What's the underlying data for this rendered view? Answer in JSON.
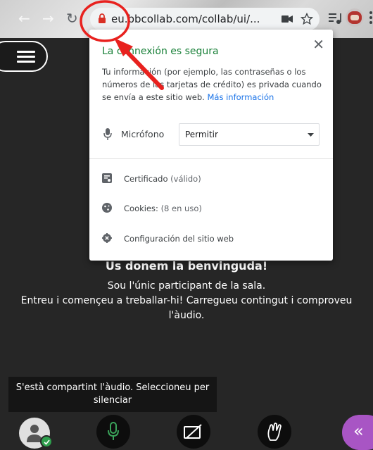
{
  "browser": {
    "url": "eu.bbcollab.com/collab/ui/...",
    "nav_glyphs": [
      "back-icon",
      "forward-icon",
      "reload-icon"
    ]
  },
  "popup": {
    "title": "La connexión es segura",
    "description": "Tu información (por ejemplo, las contraseñas o los números de las tarjetas de crédito) es privada cuando se envía a este sitio web.",
    "more_link": "Más información",
    "mic_label": "Micrófono",
    "mic_permission": "Permitir",
    "rows": [
      {
        "label": "Certificado",
        "sub": "(válido)",
        "icon": "certificate-icon"
      },
      {
        "label": "Cookies:",
        "sub": "(8 en uso)",
        "icon": "cookie-icon"
      },
      {
        "label": "Configuración del sitio web",
        "sub": "",
        "icon": "gear-icon"
      }
    ]
  },
  "welcome": {
    "title": "Us donem la benvinguda!",
    "line1": "Sou l'únic participant de la sala.",
    "line2": "Entreu i començeu a treballar-hi! Carregueu contingut i comproveu l'àudio."
  },
  "tooltip": "S'està compartint l'àudio. Seleccioneu per silenciar",
  "colors": {
    "secure_green": "#188038",
    "link_blue": "#1a73e8",
    "annotation_red": "#e8211e",
    "app_bg": "#262626",
    "mic_green": "#3aa35a",
    "panel_purple": "#a855c4"
  }
}
